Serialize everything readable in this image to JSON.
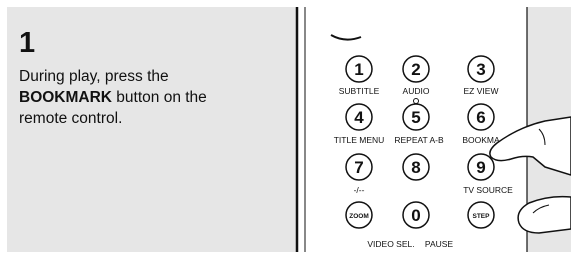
{
  "step": {
    "number": "1",
    "text_before": "During play, press the ",
    "button_name": "BOOKMARK",
    "text_after": " button on the remote control."
  },
  "remote": {
    "keys": [
      {
        "label": "1"
      },
      {
        "label": "2"
      },
      {
        "label": "3"
      },
      {
        "label": "4"
      },
      {
        "label": "5"
      },
      {
        "label": "6"
      },
      {
        "label": "7"
      },
      {
        "label": "8"
      },
      {
        "label": "9"
      },
      {
        "label": "ZOOM"
      },
      {
        "label": "0"
      },
      {
        "label": "STEP"
      }
    ],
    "row_labels": {
      "subtitle": "SUBTITLE",
      "audio": "AUDIO",
      "ez_view": "EZ VIEW",
      "title_menu": "TITLE MENU",
      "repeat_ab": "REPEAT A-B",
      "bookmark": "BOOKMA",
      "dash": "-/--",
      "tv_source": "TV SOURCE",
      "video_sel": "VIDEO SEL.",
      "pause": "PAUSE"
    },
    "colors": {
      "panel_background": "#e6e6e6",
      "remote_body": "#ffffff",
      "key_fill": "#ffffff",
      "key_stroke": "#111111"
    }
  }
}
